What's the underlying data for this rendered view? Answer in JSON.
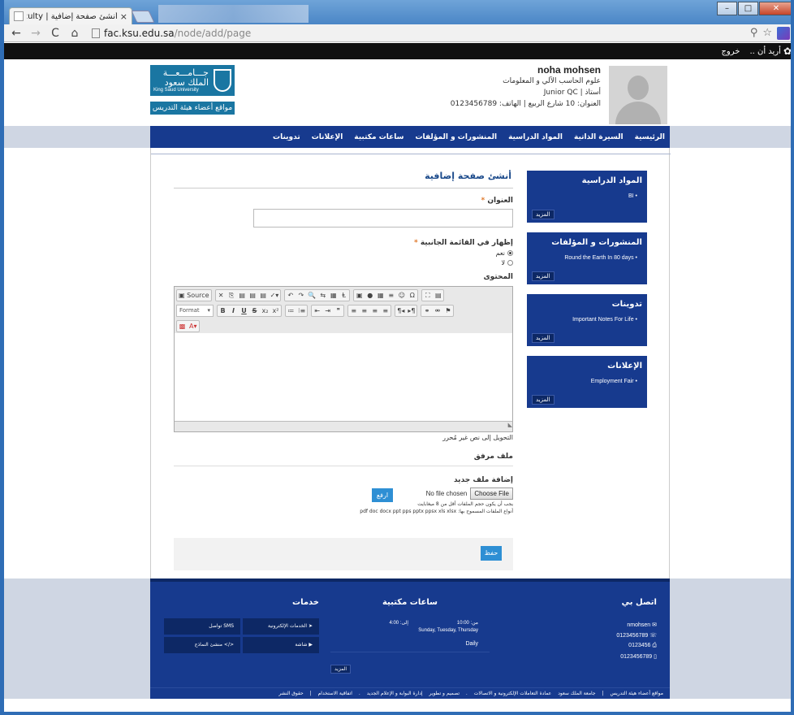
{
  "browser": {
    "tab_title": "أنشئ صفحة إضافية | Faculty",
    "url_host": "fac.ksu.edu.sa",
    "url_path": "/node/add/page",
    "window_buttons": {
      "minimize": "–",
      "maximize": "□",
      "close": "✕"
    }
  },
  "admin_bar": {
    "settings": "أريد أن ..",
    "logout": "خروج"
  },
  "profile": {
    "name": "noha mohsen",
    "department": "علوم الحاسب الآلي و المعلومات",
    "title": "أستاذ | Junior QC",
    "address": "العنوان: 10 شارع الربيع | الهاتف: 0123456789"
  },
  "logo": {
    "arabic_name": "جـــامـــعـــة الملك سعود",
    "english_name": "King Saud University",
    "subtitle": "مواقع أعضاء هيئة التدريس"
  },
  "main_nav": [
    "الرئيسية",
    "السيرة الذاتية",
    "المواد الدراسية",
    "المنشورات و المؤلفات",
    "ساعات مكتبية",
    "الإعلانات",
    "تدوينات"
  ],
  "form": {
    "page_heading": "أنشئ صفحة إضافية",
    "title_label": "العنوان",
    "required_mark": "*",
    "title_value": "",
    "sidemenu_label": "إظهار في القائمة الجانبية",
    "option_yes": "نعم",
    "option_no": "لا",
    "content_label": "المحتوى",
    "to_plain": "التحويل إلى نص غير مُحرر",
    "attached_label": "ملف مرفق",
    "new_file_label": "إضافة ملف جديد",
    "no_file": "No file chosen",
    "choose_file": "Choose File",
    "upload_button": "ارفع",
    "size_hint": "يجب أن يكون حجم الملفات أقل من 8 ميغابايت",
    "types_hint": "أنواع الملفات المسموح بها: pdf doc docx ppt pps pptx ppsx xls xlsx",
    "save_button": "حفظ",
    "editor_path": "◣"
  },
  "editor": {
    "source": "Source",
    "format": "Format",
    "row1": [
      [
        "✕",
        "⎘",
        "▤",
        "▤",
        "▤",
        "✓▾"
      ],
      [
        "↶",
        "↷",
        "🔍",
        "⇆",
        "▦",
        "Ⱡ"
      ],
      [
        "▣",
        "●",
        "▦",
        "≡",
        "☺",
        "Ω"
      ],
      [
        "⛶",
        "▤"
      ]
    ],
    "row2": [
      [
        "B",
        "I",
        "U",
        "S",
        "x₂",
        "x²"
      ],
      [
        "≔",
        "⁝≡"
      ],
      [
        "⇤",
        "⇥",
        "❞"
      ],
      [
        "≡",
        "≡",
        "≡",
        "≡"
      ],
      [
        "¶◂",
        "▸¶"
      ],
      [
        "⚭",
        "⚮",
        "⚑"
      ]
    ],
    "row3": [
      [
        "▩",
        "A▾"
      ]
    ]
  },
  "sidebar": [
    {
      "title": "المواد الدراسية",
      "item": "BI",
      "more": "المزيد"
    },
    {
      "title": "المنشورات و المؤلفات",
      "item": "Round the Earth In 80 days",
      "more": "المزيد"
    },
    {
      "title": "تدوينات",
      "item": "Important Notes For Life",
      "more": "المزيد"
    },
    {
      "title": "الإعلانات",
      "item": "Employment Fair",
      "more": "المزيد"
    }
  ],
  "footer": {
    "contact_title": "اتصل بي",
    "contact": [
      "nmohsen",
      "0123456789",
      "0123456",
      "0123456789"
    ],
    "hours_title": "ساعات مكتبية",
    "from_label": "من:",
    "from_time": "10:00",
    "to_label": "إلى:",
    "to_time": "4:00",
    "days": "Sunday, Tuesday, Thursday",
    "daily": "Daily",
    "hours_more": "المزيد",
    "services_title": "خدمات",
    "services": [
      "الخدمات الإلكترونية",
      "SMS تواصل",
      "شاشة",
      "</> منشئ النماذج"
    ],
    "bottom_links": [
      "مواقع أعضاء هيئة التدريس",
      "|",
      "جامعة الملك سعود",
      "عمادة التعاملات الإلكترونية و الاتصالات",
      ".",
      "تصميم و تطوير",
      "إدارة البوابة و الإعلام الجديد",
      ".",
      "اتفاقية الاستخدام",
      "|",
      "حقوق النشر"
    ]
  }
}
